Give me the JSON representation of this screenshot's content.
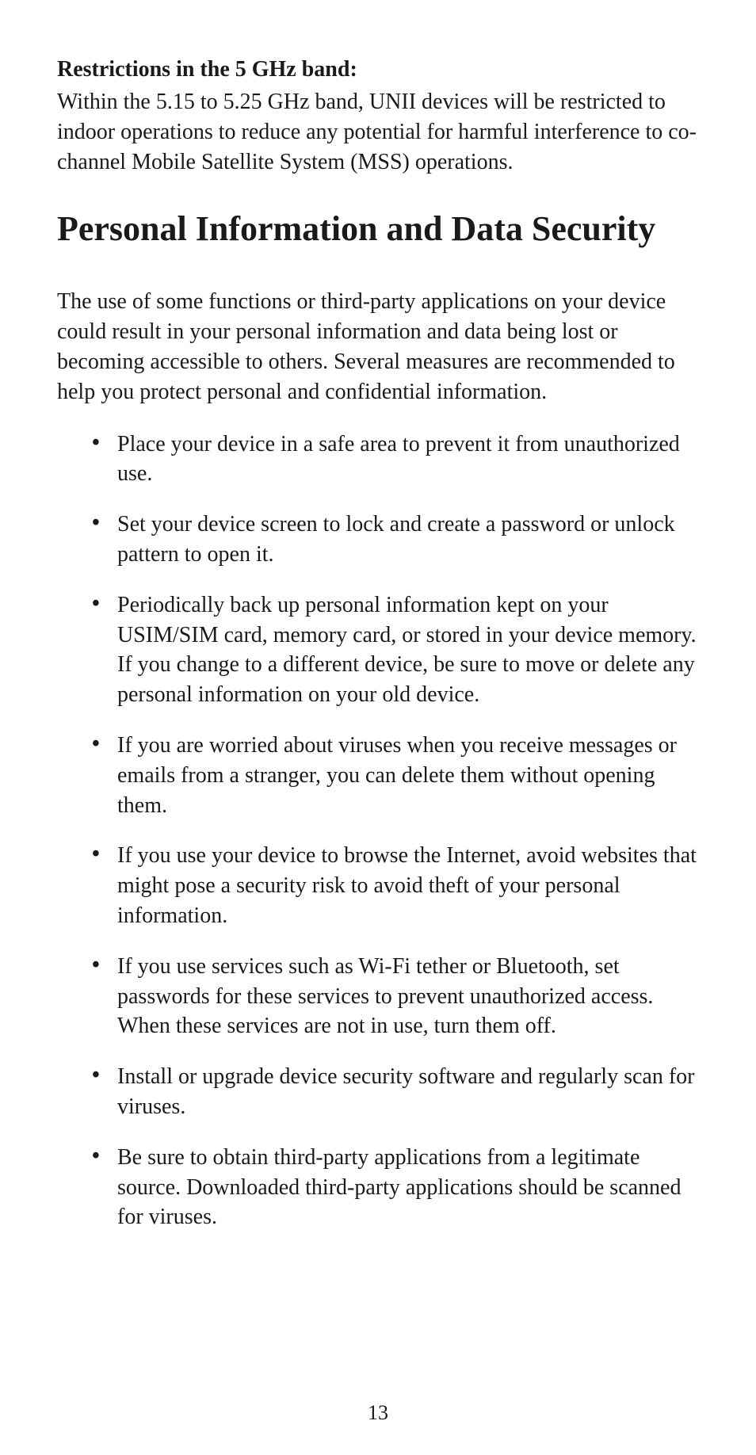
{
  "restrictions": {
    "heading": "Restrictions in the 5 GHz band:",
    "body": "Within the 5.15 to 5.25 GHz band, UNII devices will be restricted to indoor operations to reduce any potential for harmful interference to co-channel Mobile Satellite System (MSS) operations."
  },
  "section": {
    "title": "Personal Information and Data Security",
    "intro": "The use of some functions or third-party applications on your device could result in your personal information and data being lost or becoming accessible to others. Several measures are recommended to help you protect personal and confidential information.",
    "bullets": [
      "Place your device in a safe area to prevent it from unauthorized use.",
      "Set your device screen to lock and create a password or unlock pattern to open it.",
      "Periodically back up personal information kept on your USIM/SIM card, memory card, or stored in your device memory. If you change to a different device, be sure to move or delete any personal information on your old device.",
      "If you are worried about viruses when you receive messages or emails from a stranger, you can delete them without opening them.",
      "If you use your device to browse the Internet, avoid websites that might pose a security risk to avoid theft of your personal information.",
      "If you use services such as Wi-Fi tether or Bluetooth, set passwords for these services to prevent unauthorized access. When these services are not in use, turn them off.",
      "Install or upgrade device security software and regularly scan for viruses.",
      "Be sure to obtain third-party applications from a legitimate source. Downloaded third-party applications should be scanned for viruses."
    ]
  },
  "page_number": "13"
}
